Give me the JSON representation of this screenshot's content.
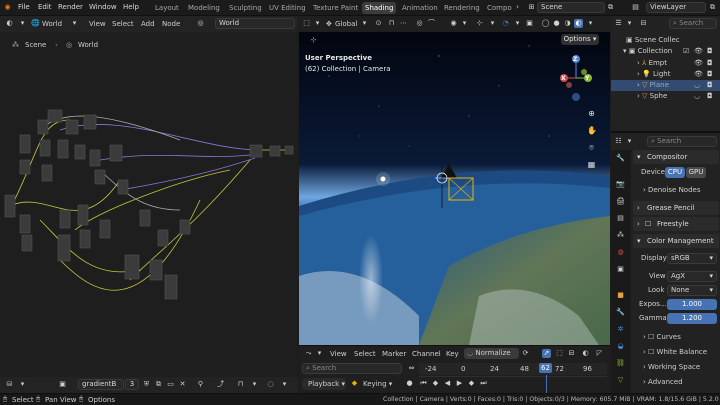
{
  "topbar": {
    "menus": [
      "File",
      "Edit",
      "Render",
      "Window",
      "Help"
    ],
    "editor_type": "World",
    "workspaces": [
      "Layout",
      "Modeling",
      "Sculpting",
      "UV Editing",
      "Texture Paint",
      "Shading",
      "Animation",
      "Rendering",
      "Compo"
    ],
    "active_workspace": "Shading",
    "scene": "Scene",
    "view_layer": "ViewLayer"
  },
  "node_editor": {
    "header_world": "World",
    "menus": [
      "View",
      "Select",
      "Add",
      "Node"
    ],
    "world_field": "World",
    "breadcrumb_scene": "Scene",
    "breadcrumb_world": "World",
    "footer_name": "gradientB",
    "footer_users": "3"
  },
  "viewport": {
    "orientation": "Global",
    "options": "Options",
    "perspective": "User Perspective",
    "collection_info": "(62) Collection | Camera",
    "gizmo": {
      "x": "X",
      "y": "Y",
      "z": "Z"
    }
  },
  "timeline": {
    "menus": [
      "View",
      "Select",
      "Marker",
      "Channel",
      "Key"
    ],
    "normalize": "Normalize",
    "search_placeholder": "Search",
    "frames": [
      "-24",
      "0",
      "24",
      "48",
      "62",
      "72",
      "96"
    ],
    "current_frame": "62",
    "playback": "Playback",
    "keying": "Keying"
  },
  "outliner": {
    "search_placeholder": "Search",
    "items": [
      {
        "label": "Scene Collec",
        "indent": 0
      },
      {
        "label": "Collection",
        "indent": 1
      },
      {
        "label": "Empt",
        "indent": 2
      },
      {
        "label": "Light",
        "indent": 2
      },
      {
        "label": "Plane",
        "indent": 2
      },
      {
        "label": "Sphe",
        "indent": 2
      }
    ]
  },
  "properties": {
    "search_placeholder": "Search",
    "compositor": "Compositor",
    "device_label": "Device",
    "device_cpu": "CPU",
    "device_gpu": "GPU",
    "denoise": "Denoise Nodes",
    "grease_pencil": "Grease Pencil",
    "freestyle": "Freestyle",
    "color_management": "Color Management",
    "display_label": "Display",
    "display_value": "sRGB",
    "view_label": "View",
    "view_value": "AgX",
    "look_label": "Look",
    "look_value": "None",
    "exposure_label": "Expos...",
    "exposure_value": "1.000",
    "gamma_label": "Gamma",
    "gamma_value": "1.200",
    "curves": "Curves",
    "white_balance": "White Balance",
    "working_space": "Working Space",
    "advanced": "Advanced"
  },
  "statusbar": {
    "select": "Select",
    "pan_view": "Pan View",
    "options": "Options",
    "stats": "Collection | Camera | Verts:0 | Faces:0 | Tris:0 | Objects:0/3 | Memory: 605.7 MiB | VRAM: 1.8/15.6 GiB | 5.2.0"
  },
  "colors": {
    "accent": "#4772b3",
    "background": "#1d1d1d",
    "frame_marker": "#4772b3"
  }
}
